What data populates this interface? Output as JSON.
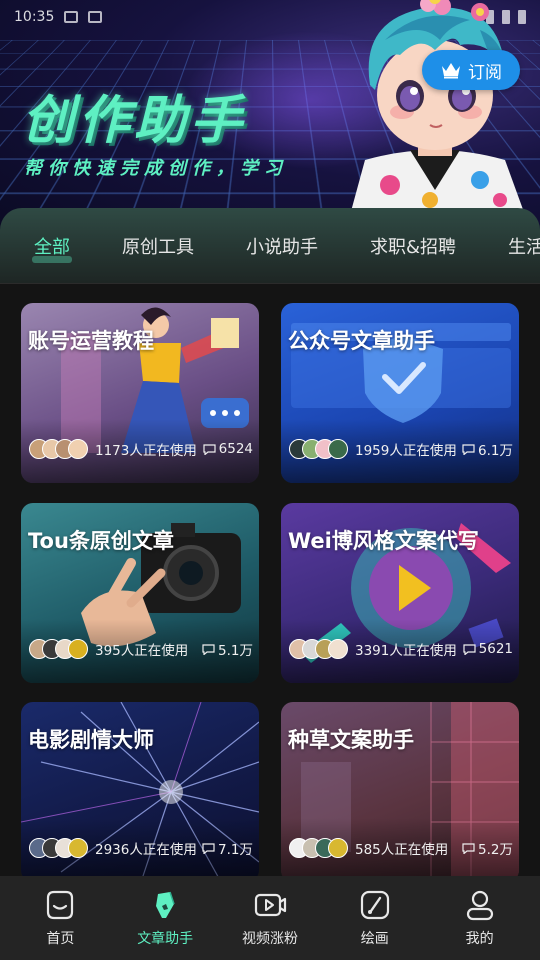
{
  "status_bar": {
    "time": "10:35"
  },
  "banner": {
    "title": "创作助手",
    "subtitle": "帮你快速完成创作，学习",
    "subscribe_label": "订阅"
  },
  "tabs": [
    {
      "label": "全部",
      "active": true
    },
    {
      "label": "原创工具",
      "active": false
    },
    {
      "label": "小说助手",
      "active": false
    },
    {
      "label": "求职&招聘",
      "active": false
    },
    {
      "label": "生活学",
      "active": false
    }
  ],
  "cards": [
    {
      "title": "账号运营教程",
      "users": "1173人正在使用",
      "comments": "6524"
    },
    {
      "title": "公众号文章助手",
      "users": "1959人正在使用",
      "comments": "6.1万"
    },
    {
      "title": "Tou条原创文章",
      "users": "395人正在使用",
      "comments": "5.1万"
    },
    {
      "title": "Wei博风格文案代写",
      "users": "3391人正在使用",
      "comments": "5621"
    },
    {
      "title": "电影剧情大师",
      "users": "2936人正在使用",
      "comments": "7.1万"
    },
    {
      "title": "种草文案助手",
      "users": "585人正在使用",
      "comments": "5.2万"
    }
  ],
  "nav": [
    {
      "label": "首页",
      "icon": "home-icon",
      "active": false
    },
    {
      "label": "文章助手",
      "icon": "article-pen-icon",
      "active": true
    },
    {
      "label": "视频涨粉",
      "icon": "video-play-icon",
      "active": false
    },
    {
      "label": "绘画",
      "icon": "brush-icon",
      "active": false
    },
    {
      "label": "我的",
      "icon": "profile-icon",
      "active": false
    }
  ],
  "colors": {
    "accent": "#5ef0c2",
    "subscribe_button": "#1e8fe8",
    "background": "#141414",
    "nav_background": "#242424"
  }
}
